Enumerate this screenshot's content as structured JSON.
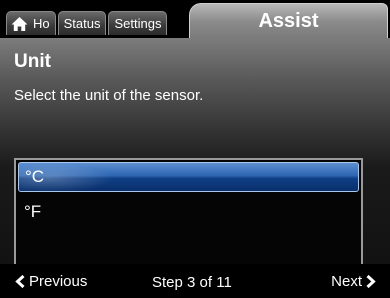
{
  "tabs": {
    "home_label": "Ho",
    "status_label": "Status",
    "settings_label": "Settings",
    "active_label": "Assist"
  },
  "icons": {
    "home": "house-icon",
    "previous": "chevron-left-icon",
    "next": "chevron-right-icon"
  },
  "colors": {
    "selection": "#2e66b2",
    "background": "#000000",
    "text": "#ffffff"
  },
  "main": {
    "title": "Unit",
    "subtitle": "Select the unit of the sensor.",
    "options": [
      {
        "label": "°C",
        "selected": true
      },
      {
        "label": "°F",
        "selected": false
      }
    ]
  },
  "footer": {
    "previous_label": "Previous",
    "step_label": "Step 3 of 11",
    "next_label": "Next"
  }
}
